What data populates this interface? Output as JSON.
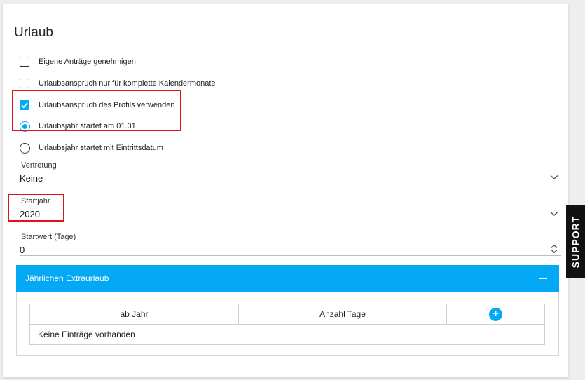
{
  "section": {
    "title": "Urlaub"
  },
  "options": {
    "own_requests": {
      "label": "Eigene Anträge genehmigen",
      "checked": false
    },
    "full_months": {
      "label": "Urlaubsanspruch nur für komplette Kalendermonate",
      "checked": false
    },
    "use_profile": {
      "label": "Urlaubsanspruch des Profils verwenden",
      "checked": true
    },
    "year_start_fixed": {
      "label": "Urlaubsjahr startet am 01.01",
      "selected": true
    },
    "year_start_entry": {
      "label": "Urlaubsjahr startet mit Eintrittsdatum",
      "selected": false
    }
  },
  "fields": {
    "vertretung": {
      "label": "Vertretung",
      "value": "Keine"
    },
    "startjahr": {
      "label": "Startjahr",
      "value": "2020"
    },
    "startwert": {
      "label": "Startwert (Tage)",
      "value": "0"
    }
  },
  "extra_leave": {
    "title": "Jährlichen Extraurlaub",
    "columns": [
      "ab Jahr",
      "Anzahl Tage"
    ],
    "add_symbol": "+",
    "empty_text": "Keine Einträge vorhanden"
  },
  "support": {
    "label": "SUPPORT"
  },
  "colors": {
    "accent": "#03a9f4",
    "highlight": "#e0131b"
  },
  "icons": [
    "checkmark-icon",
    "chevron-down-icon",
    "spinner-icon",
    "minus-icon",
    "plus-icon"
  ]
}
